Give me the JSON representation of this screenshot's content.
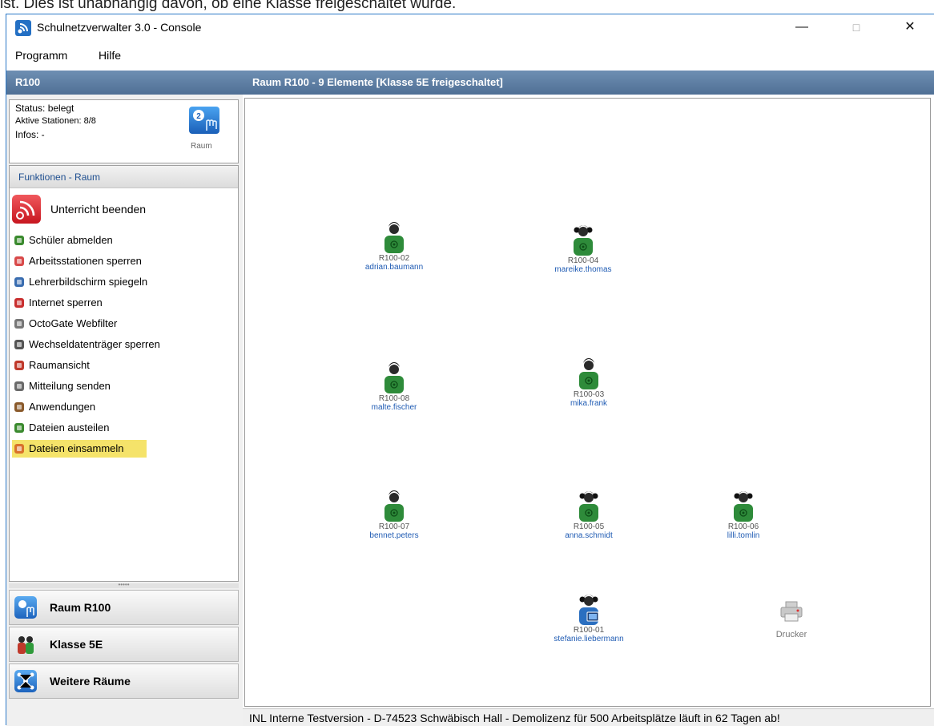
{
  "doc_text": "ist. Dies ist unabhängig davon, ob eine Klasse freigeschaltet wurde.",
  "window": {
    "title": "Schulnetzverwalter 3.0 - Console",
    "minimize": "—",
    "maximize": "□",
    "close": "✕"
  },
  "menu": [
    "Programm",
    "Hilfe"
  ],
  "left": {
    "header": "R100",
    "status": "Status: belegt",
    "stations": "Aktive Stationen: 8/8",
    "infos": "Infos: -",
    "raum_label": "Raum",
    "functions_header": "Funktionen - Raum",
    "primary_action": "Unterricht beenden",
    "functions": [
      {
        "label": "Schüler abmelden",
        "icon": "user-logout-icon",
        "color": "#3a8a2e"
      },
      {
        "label": "Arbeitsstationen sperren",
        "icon": "lock-station-icon",
        "color": "#d84a4a"
      },
      {
        "label": "Lehrerbildschirm spiegeln",
        "icon": "monitor-mirror-icon",
        "color": "#3a6db0"
      },
      {
        "label": "Internet sperren",
        "icon": "internet-lock-icon",
        "color": "#c93030"
      },
      {
        "label": "OctoGate Webfilter",
        "icon": "filter-icon",
        "color": "#777777"
      },
      {
        "label": "Wechseldatenträger sperren",
        "icon": "usb-lock-icon",
        "color": "#555555"
      },
      {
        "label": "Raumansicht",
        "icon": "room-view-icon",
        "color": "#c0392b"
      },
      {
        "label": "Mitteilung senden",
        "icon": "message-icon",
        "color": "#6a6a6a"
      },
      {
        "label": "Anwendungen",
        "icon": "applications-icon",
        "color": "#8a5a2b"
      },
      {
        "label": "Dateien austeilen",
        "icon": "files-distribute-icon",
        "color": "#3a8a2e"
      },
      {
        "label": "Dateien einsammeln",
        "icon": "files-collect-icon",
        "color": "#d9722b"
      }
    ],
    "nav": [
      {
        "label": "Raum R100",
        "color": "#2f7fd6"
      },
      {
        "label": "Klasse 5E",
        "color": "#2f9a3a"
      },
      {
        "label": "Weitere Räume",
        "color": "#2f7fd6"
      }
    ]
  },
  "main": {
    "header": "Raum R100 - 9 Elemente [Klasse 5E freigeschaltet]",
    "stations": [
      {
        "id": "R100-02",
        "user": "adrian.baumann",
        "kind": "male"
      },
      {
        "id": "R100-04",
        "user": "mareike.thomas",
        "kind": "female"
      },
      {
        "id": "R100-08",
        "user": "malte.fischer",
        "kind": "male"
      },
      {
        "id": "R100-03",
        "user": "mika.frank",
        "kind": "male"
      },
      {
        "id": "R100-07",
        "user": "bennet.peters",
        "kind": "male"
      },
      {
        "id": "R100-05",
        "user": "anna.schmidt",
        "kind": "female"
      },
      {
        "id": "R100-06",
        "user": "lilli.tomlin",
        "kind": "female"
      },
      {
        "id": "R100-01",
        "user": "stefanie.liebermann",
        "kind": "teacher"
      }
    ],
    "printer": "Drucker"
  },
  "status_bar": "INL Interne Testversion - D-74523 Schwäbisch Hall - Demolizenz für 500 Arbeitsplätze läuft in 62 Tagen ab!",
  "colors": {
    "header_blue": "#5a7aa0",
    "student_green": "#2e8b3a",
    "teacher_blue": "#2b6fc0",
    "highlight": "#f5e36a"
  }
}
